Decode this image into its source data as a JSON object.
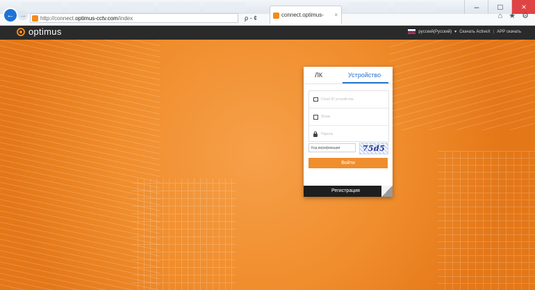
{
  "browser": {
    "address_path": "http://connect.",
    "address_domain": "optimus-cctv.com",
    "address_rest": "/index",
    "address_tools": "ρ - ¢",
    "active_tab_title": "connect.optimus-cctv.com",
    "tab_close": "×",
    "window_minimize": "–",
    "window_maximize": "□",
    "window_close": "×",
    "toolbar_icons": "⌂ ★ ⚙"
  },
  "site_header": {
    "logo_text": "optimus",
    "language": "русский(Русский)",
    "language_arrow": "▾",
    "download_activex": "Скачать ActiveX",
    "separator": "|",
    "app_download": "APP скачать"
  },
  "login": {
    "tabs": [
      {
        "label": "ЛК"
      },
      {
        "label": "Устройство"
      }
    ],
    "active_tab": "Устройство",
    "fields": [
      {
        "placeholder": "Cloud ID устройства"
      },
      {
        "placeholder": "Логин"
      },
      {
        "placeholder": "Пароль"
      }
    ],
    "captcha_placeholder": "Код верификации",
    "captcha_code": "75d5",
    "submit_label": "Войти",
    "register_label": "Регистрация"
  },
  "colors": {
    "accent": "#f08d2c",
    "tab_active": "#2a74c8",
    "header_bg": "#2a2a2a"
  }
}
